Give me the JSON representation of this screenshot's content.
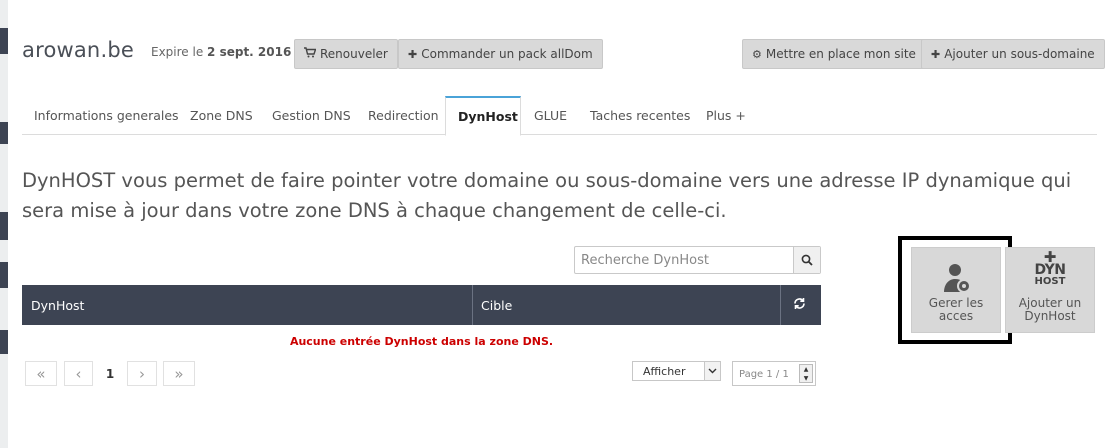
{
  "domain": {
    "name": "arowan.be",
    "expire_prefix": "Expire le",
    "expire_date": "2 sept. 2016"
  },
  "actions": {
    "renew": "Renouveler",
    "order_pack": "Commander un pack allDom",
    "setup_site": "Mettre en place mon site",
    "add_subdomain": "Ajouter un sous-domaine"
  },
  "tabs": [
    {
      "label": "Informations generales"
    },
    {
      "label": "Zone DNS"
    },
    {
      "label": "Gestion DNS"
    },
    {
      "label": "Redirection"
    },
    {
      "label": "DynHost",
      "active": true
    },
    {
      "label": "GLUE"
    },
    {
      "label": "Taches recentes"
    },
    {
      "label": "Plus +"
    }
  ],
  "intro": "DynHOST vous permet de faire pointer votre domaine ou sous-domaine vers une adresse IP dynamique qui sera mise à jour dans votre zone DNS à chaque changement de celle-ci.",
  "search": {
    "placeholder": "Recherche DynHost"
  },
  "table": {
    "columns": [
      "DynHost",
      "Cible"
    ],
    "empty_message": "Aucune entrée DynHost dans la zone DNS."
  },
  "pagination": {
    "current_page": "1",
    "per_page_label": "Afficher",
    "page_status": "Page 1 / 1"
  },
  "tiles": {
    "manage_access": "Gerer les acces",
    "add_dynhost": "Ajouter un DynHost",
    "dyn_logo_line1": "DYN",
    "dyn_logo_line2": "HOST"
  },
  "icons": [
    "cart-icon",
    "plus-icon",
    "gears-icon",
    "search-icon",
    "refresh-icon",
    "user-gear-icon",
    "dynhost-add-icon",
    "first-page-icon",
    "prev-page-icon",
    "next-page-icon",
    "last-page-icon",
    "caret-down-icon"
  ],
  "colors": {
    "table_header": "#3d4453",
    "active_tab_accent": "#4aa3d8",
    "error_text": "#cc0000",
    "button_bg": "#d9d9d9"
  }
}
